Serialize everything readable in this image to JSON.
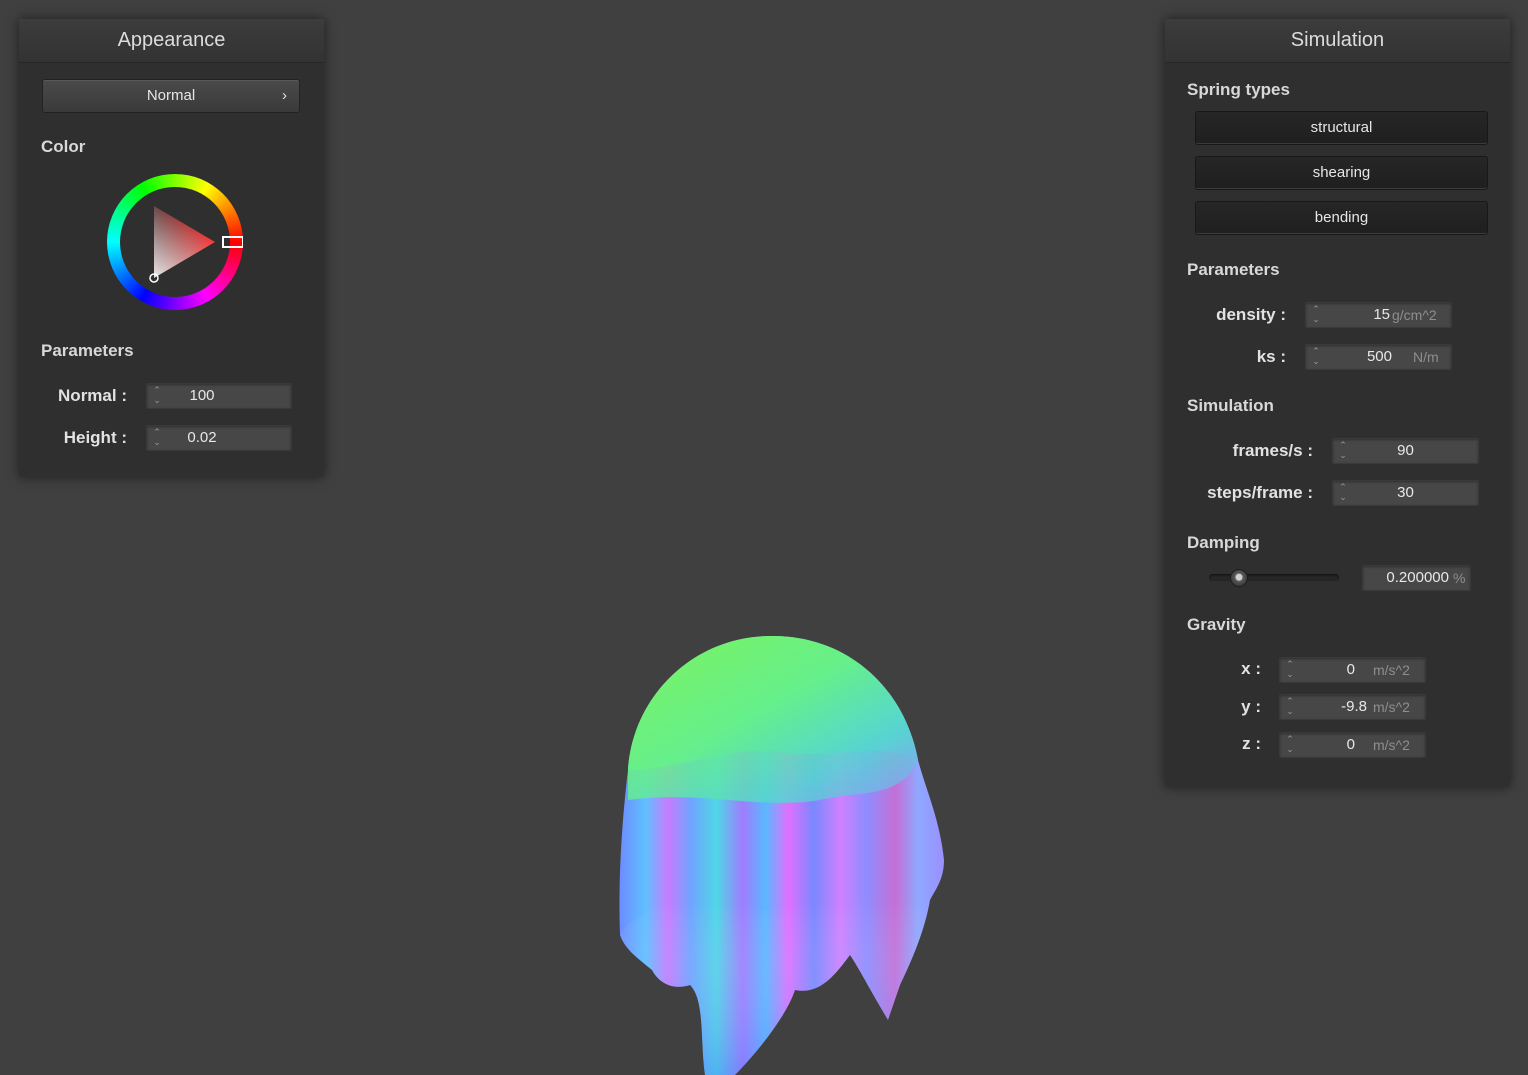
{
  "appearance": {
    "title": "Appearance",
    "shader_select": "Normal",
    "color_label": "Color",
    "selected_color": "#ff0000",
    "parameters_label": "Parameters",
    "normal_label": "Normal :",
    "normal_value": "100",
    "height_label": "Height :",
    "height_value": "0.02"
  },
  "simulation": {
    "title": "Simulation",
    "spring_types_label": "Spring types",
    "spring_buttons": [
      "structural",
      "shearing",
      "bending"
    ],
    "parameters_label": "Parameters",
    "density_label": "density :",
    "density_value": "15",
    "density_unit": "g/cm^2",
    "ks_label": "ks :",
    "ks_value": "500",
    "ks_unit": "N/m",
    "simulation_label": "Simulation",
    "fps_label": "frames/s :",
    "fps_value": "90",
    "steps_label": "steps/frame :",
    "steps_value": "30",
    "damping_label": "Damping",
    "damping_value": "0.200000",
    "damping_unit": "%",
    "damping_fraction": 0.2,
    "gravity_label": "Gravity",
    "gx_label": "x :",
    "gx_value": "0",
    "gy_label": "y :",
    "gy_value": "-9.8",
    "gz_label": "z :",
    "gz_value": "0",
    "gravity_unit": "m/s^2"
  },
  "viewport": {
    "scene": "cloth draped over sphere, normal shading"
  }
}
